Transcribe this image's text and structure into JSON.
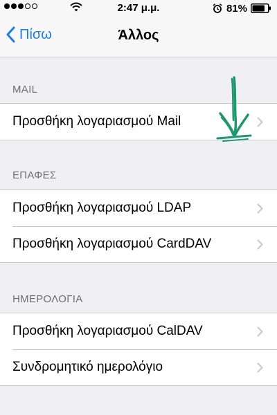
{
  "status_bar": {
    "signal_filled": 3,
    "signal_total": 5,
    "time": "2:47 μ.μ.",
    "battery_pct": "81%",
    "battery_level": 0.81
  },
  "nav": {
    "back_label": "Πίσω",
    "title": "Άλλος"
  },
  "sections": [
    {
      "header": "MAIL",
      "rows": [
        {
          "label": "Προσθήκη λογαριασμού Mail"
        }
      ]
    },
    {
      "header": "ΕΠΑΦΕΣ",
      "rows": [
        {
          "label": "Προσθήκη λογαριασμού LDAP"
        },
        {
          "label": "Προσθήκη λογαριασμού CardDAV"
        }
      ]
    },
    {
      "header": "ΗΜΕΡΟΛΟΓΙΑ",
      "rows": [
        {
          "label": "Προσθήκη λογαριασμού CalDAV"
        },
        {
          "label": "Συνδρομητικό ημερολόγιο"
        }
      ]
    }
  ],
  "colors": {
    "accent": "#1a7cf4",
    "annotation": "#1a9a6c",
    "background": "#efeff4",
    "section_header": "#6d6d72",
    "chevron": "#c7c7cc"
  }
}
